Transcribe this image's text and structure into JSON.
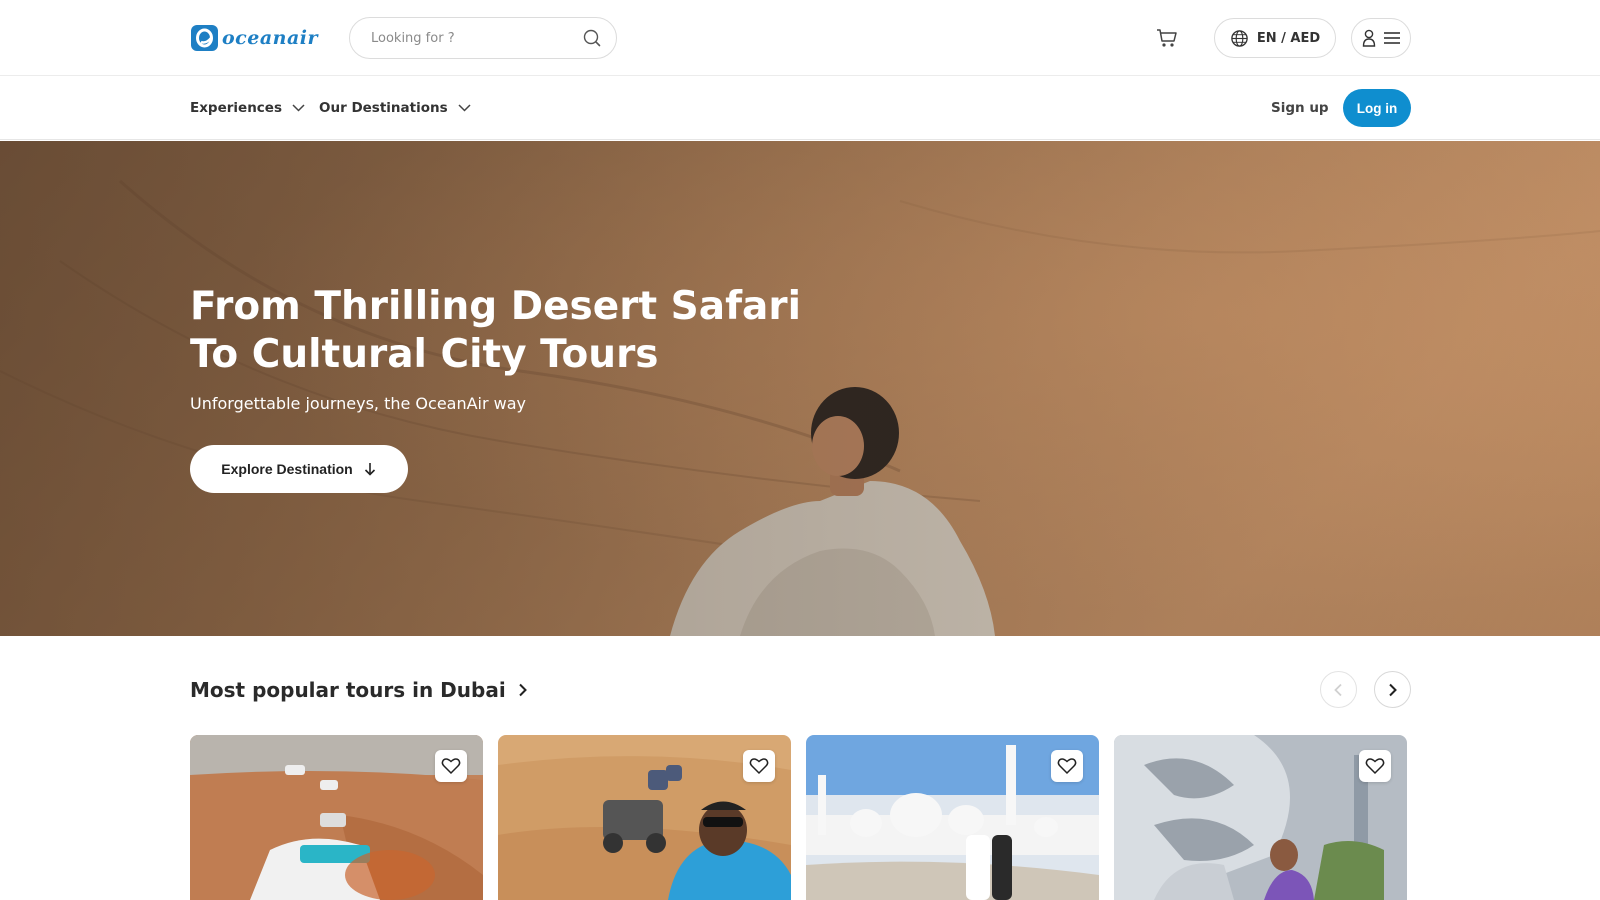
{
  "brand": {
    "name": "oceanair",
    "accent": "#0f8ecf",
    "logo_color": "#1e7fc4"
  },
  "header": {
    "search": {
      "placeholder": "Looking for ?",
      "value": "",
      "icon": "search-icon"
    },
    "cart_icon": "cart-icon",
    "locale": {
      "label": "EN / AED",
      "icon": "globe-icon"
    },
    "account_icons": [
      "user-icon",
      "menu-icon"
    ]
  },
  "nav": {
    "items": [
      {
        "label": "Experiences",
        "icon": "chevron-down-icon"
      },
      {
        "label": "Our Destinations",
        "icon": "chevron-down-icon"
      }
    ],
    "signup_label": "Sign up",
    "login_label": "Log in"
  },
  "hero": {
    "title": "From Thrilling Desert Safari To Cultural City Tours",
    "subtitle": "Unforgettable journeys, the OceanAir way",
    "cta_label": "Explore Destination",
    "cta_icon": "arrow-down-icon"
  },
  "popular": {
    "title": "Most popular tours in Dubai",
    "title_icon": "chevron-right-icon",
    "prev_icon": "chevron-left-icon",
    "next_icon": "chevron-right-icon",
    "cards": [
      {
        "favorite_icon": "heart-icon"
      },
      {
        "favorite_icon": "heart-icon"
      },
      {
        "favorite_icon": "heart-icon"
      },
      {
        "favorite_icon": "heart-icon"
      }
    ]
  }
}
